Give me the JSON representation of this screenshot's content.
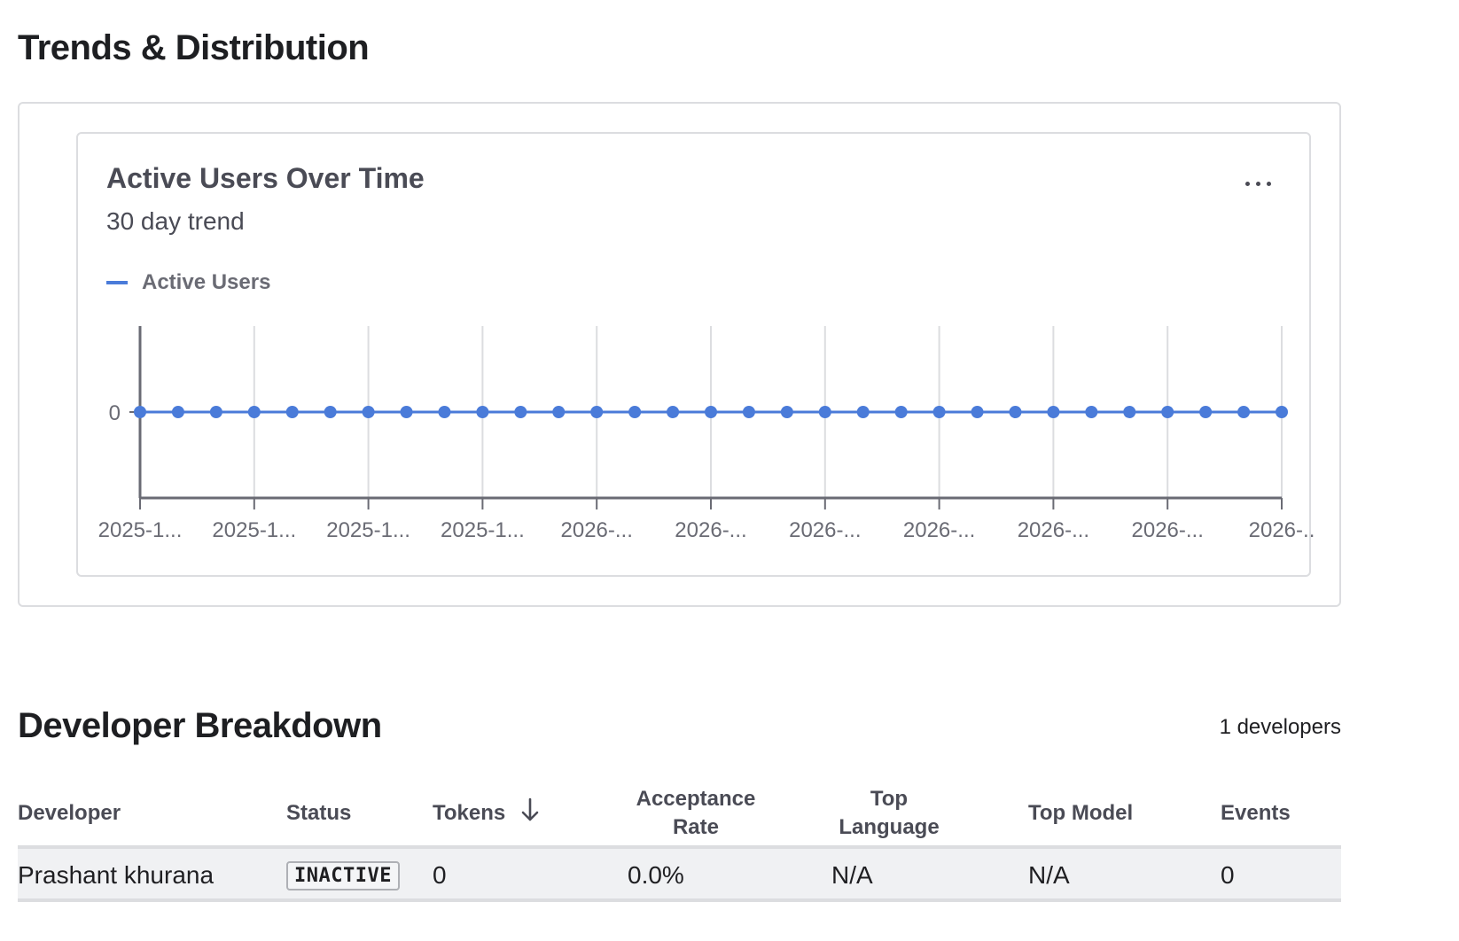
{
  "trends": {
    "title": "Trends & Distribution"
  },
  "chart_card": {
    "title": "Active Users Over Time",
    "subtitle": "30 day trend",
    "more_icon": "more-horizontal-icon"
  },
  "chart_data": {
    "type": "line",
    "series": [
      {
        "name": "Active Users",
        "color": "#4a7bd9",
        "values": [
          0,
          0,
          0,
          0,
          0,
          0,
          0,
          0,
          0,
          0,
          0,
          0,
          0,
          0,
          0,
          0,
          0,
          0,
          0,
          0,
          0,
          0,
          0,
          0,
          0,
          0,
          0,
          0,
          0,
          0,
          0
        ]
      }
    ],
    "x_tick_labels": [
      "2025-1...",
      "2025-1...",
      "2025-1...",
      "2025-1...",
      "2026-...",
      "2026-...",
      "2026-...",
      "2026-...",
      "2026-...",
      "2026-...",
      "2026-.."
    ],
    "y_tick_labels": [
      "0"
    ],
    "xlabel": "",
    "ylabel": "",
    "grid": "vertical",
    "legend": "top-left"
  },
  "breakdown": {
    "title": "Developer Breakdown",
    "count_label": "1 developers",
    "columns": {
      "developer": "Developer",
      "status": "Status",
      "tokens": "Tokens",
      "acceptance_line1": "Acceptance",
      "acceptance_line2": "Rate",
      "language_line1": "Top",
      "language_line2": "Language",
      "model": "Top Model",
      "events": "Events"
    },
    "sort_icon": "arrow-down-icon",
    "rows": [
      {
        "developer": "Prashant khurana",
        "status": "INACTIVE",
        "tokens": "0",
        "acceptance": "0.0%",
        "language": "N/A",
        "model": "N/A",
        "events": "0"
      }
    ]
  }
}
